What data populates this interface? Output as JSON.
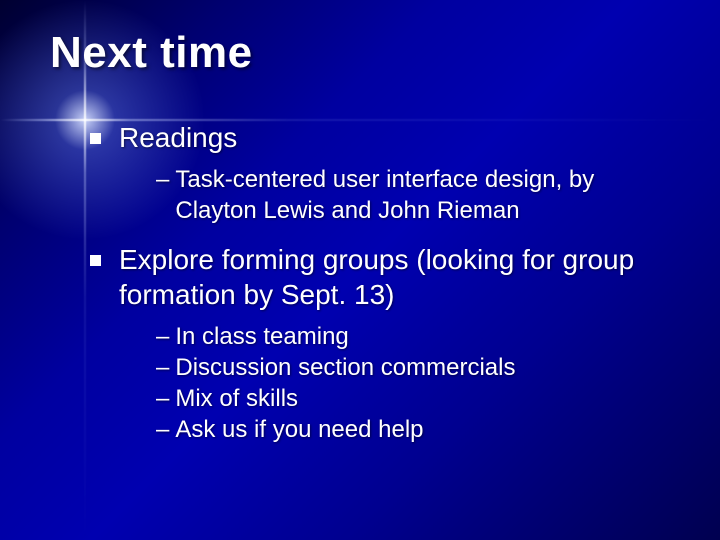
{
  "title": "Next time",
  "items": [
    {
      "label": "Readings",
      "sub": [
        "Task-centered user interface design, by Clayton Lewis and John Rieman"
      ]
    },
    {
      "label": "Explore forming groups (looking for group formation by Sept. 13)",
      "sub": [
        "In class teaming",
        "Discussion section commercials",
        "Mix of skills",
        "Ask us if you need help"
      ]
    }
  ]
}
